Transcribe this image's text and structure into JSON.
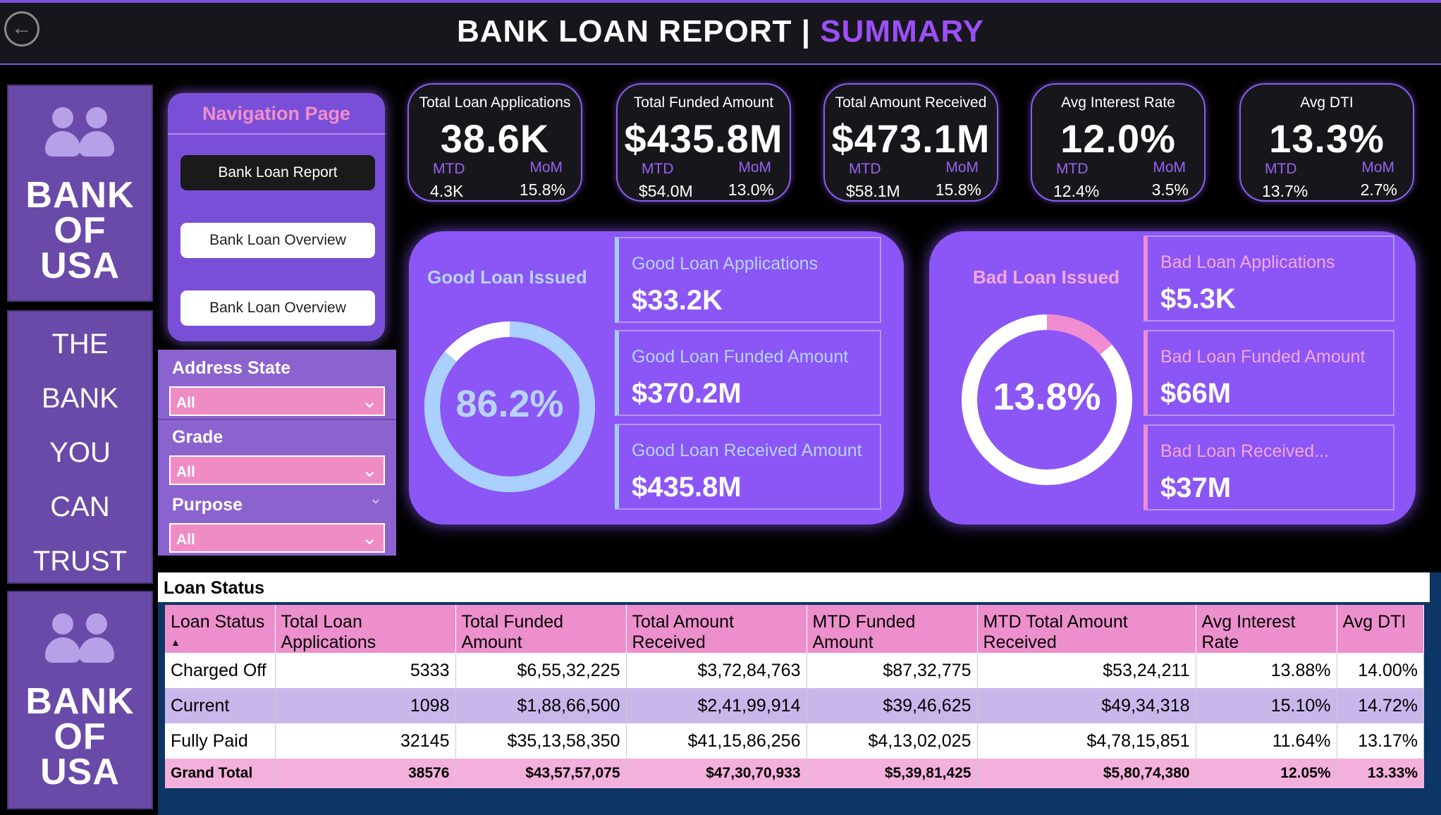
{
  "header": {
    "back_icon": "back-arrow-icon",
    "title_main": "BANK LOAN REPORT | ",
    "title_accent": "SUMMARY",
    "accent_color": "#9b4ff5"
  },
  "brand": {
    "name_line1": "BANK",
    "name_line2": "OF",
    "name_line3": "USA",
    "tagline": [
      "THE",
      "BANK",
      "YOU",
      "CAN",
      "TRUST"
    ],
    "icon": "people-icon"
  },
  "nav": {
    "title": "Navigation Page",
    "buttons": [
      "Bank Loan Report",
      "Bank Loan Overview",
      "Bank Loan Overview"
    ]
  },
  "filters": [
    {
      "label": "Address State",
      "value": "All"
    },
    {
      "label": "Grade",
      "value": "All"
    },
    {
      "label": "Purpose",
      "value": "All"
    }
  ],
  "kpis": [
    {
      "title": "Total Loan Applications",
      "value": "38.6K",
      "mtd_label": "MTD",
      "mtd": "4.3K",
      "mom_label": "MoM",
      "mom": "15.8%"
    },
    {
      "title": "Total Funded Amount",
      "value": "$435.8M",
      "mtd_label": "MTD",
      "mtd": "$54.0M",
      "mom_label": "MoM",
      "mom": "13.0%"
    },
    {
      "title": "Total Amount Received",
      "value": "$473.1M",
      "mtd_label": "MTD",
      "mtd": "$58.1M",
      "mom_label": "MoM",
      "mom": "15.8%"
    },
    {
      "title": "Avg Interest Rate",
      "value": "12.0%",
      "mtd_label": "MTD",
      "mtd": "12.4%",
      "mom_label": "MoM",
      "mom": "3.5%"
    },
    {
      "title": "Avg DTI",
      "value": "13.3%",
      "mtd_label": "MTD",
      "mtd": "13.7%",
      "mom_label": "MoM",
      "mom": "2.7%"
    }
  ],
  "good_loan": {
    "title": "Good Loan Issued",
    "percent_label": "86.2%",
    "percent": 86.2,
    "ring_color": "#a9d0ff",
    "metrics": [
      {
        "label": "Good Loan Applications",
        "value": "$33.2K"
      },
      {
        "label": "Good Loan Funded Amount",
        "value": "$370.2M"
      },
      {
        "label": "Good Loan Received Amount",
        "value": "$435.8M"
      }
    ]
  },
  "bad_loan": {
    "title": "Bad Loan Issued",
    "percent_label": "13.8%",
    "percent": 13.8,
    "ring_color": "#f08ccf",
    "metrics": [
      {
        "label": "Bad Loan Applications",
        "value": "$5.3K"
      },
      {
        "label": "Bad Loan Funded Amount",
        "value": "$66M"
      },
      {
        "label": "Bad Loan Received...",
        "value": "$37M"
      }
    ]
  },
  "table": {
    "title": "Loan Status",
    "columns": [
      "Loan Status",
      "Total Loan Applications",
      "Total Funded Amount",
      "Total Amount Received",
      "MTD Funded Amount",
      "MTD Total Amount Received",
      "Avg Interest Rate",
      "Avg DTI"
    ],
    "rows": [
      [
        "Charged Off",
        "5333",
        "$6,55,32,225",
        "$3,72,84,763",
        "$87,32,775",
        "$53,24,211",
        "13.88%",
        "14.00%"
      ],
      [
        "Current",
        "1098",
        "$1,88,66,500",
        "$2,41,99,914",
        "$39,46,625",
        "$49,34,318",
        "15.10%",
        "14.72%"
      ],
      [
        "Fully Paid",
        "32145",
        "$35,13,58,350",
        "$41,15,86,256",
        "$4,13,02,025",
        "$4,78,15,851",
        "11.64%",
        "13.17%"
      ]
    ],
    "total": [
      "Grand Total",
      "38576",
      "$43,57,57,075",
      "$47,30,70,933",
      "$5,39,81,425",
      "$5,80,74,380",
      "12.05%",
      "13.33%"
    ]
  }
}
